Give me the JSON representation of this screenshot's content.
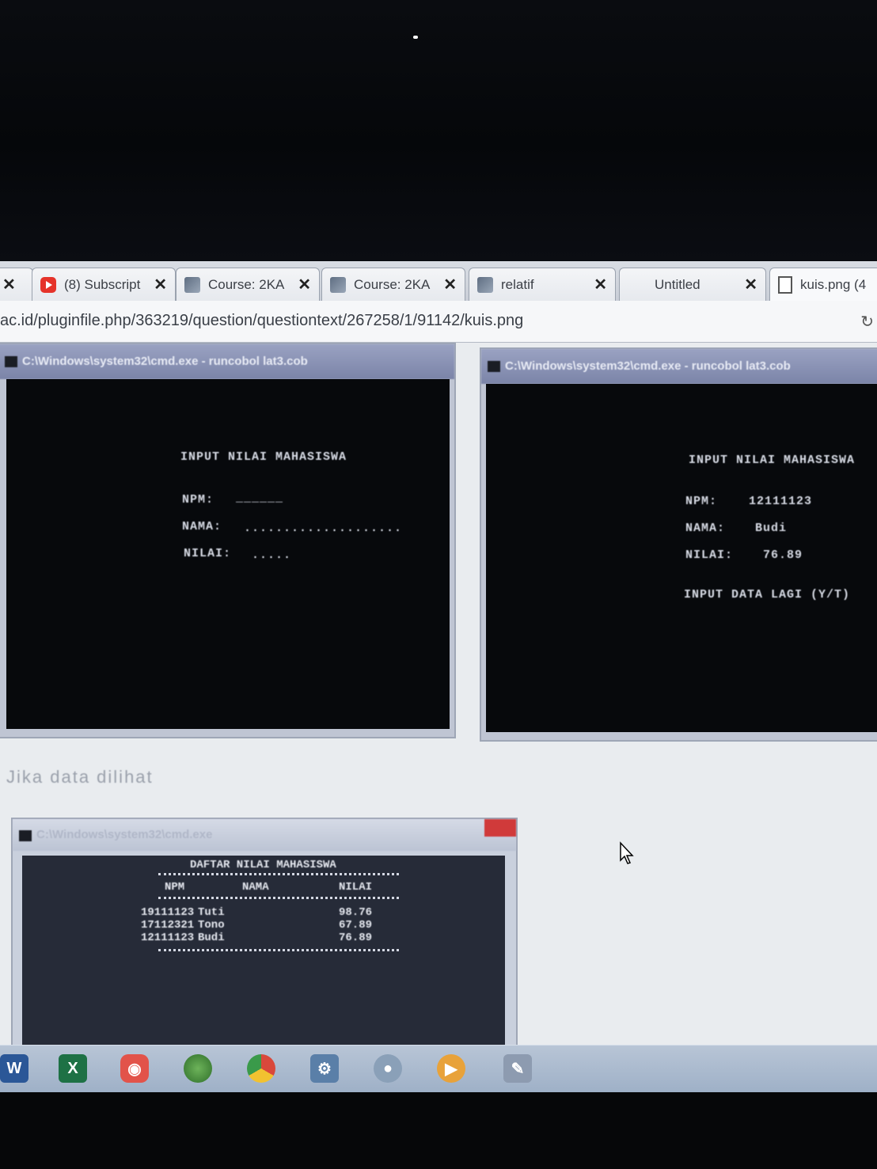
{
  "tabs": [
    {
      "label": "",
      "icon": "close-icon"
    },
    {
      "label": "(8) Subscript",
      "icon": "youtube-icon"
    },
    {
      "label": "Course: 2KA",
      "icon": "course-icon"
    },
    {
      "label": "Course: 2KA",
      "icon": "course-icon"
    },
    {
      "label": "relatif",
      "icon": "course-icon"
    },
    {
      "label": "Untitled",
      "icon": ""
    },
    {
      "label": "kuis.png (4",
      "icon": "document-icon"
    }
  ],
  "address_bar": {
    "url": "ac.id/pluginfile.php/363219/question/questiontext/267258/1/91142/kuis.png"
  },
  "cmd_left": {
    "title": "C:\\Windows\\system32\\cmd.exe - runcobol lat3.cob",
    "heading": "INPUT NILAI MAHASISWA",
    "npm_label": "NPM:",
    "npm_value": "______",
    "nama_label": "NAMA:",
    "nama_value": "....................",
    "nilai_label": "NILAI:",
    "nilai_value": "....."
  },
  "cmd_right": {
    "title": "C:\\Windows\\system32\\cmd.exe - runcobol lat3.cob",
    "heading": "INPUT NILAI MAHASISWA",
    "npm_label": "NPM:",
    "npm_value": "12111123",
    "nama_label": "NAMA:",
    "nama_value": "Budi",
    "nilai_label": "NILAI:",
    "nilai_value": "76.89",
    "prompt": "INPUT DATA LAGI (Y/T)"
  },
  "caption": "Jika data dilihat",
  "cmd_table": {
    "title": "C:\\Windows\\system32\\cmd.exe",
    "heading": "DAFTAR NILAI MAHASISWA",
    "columns": [
      "NPM",
      "NAMA",
      "NILAI"
    ],
    "rows": [
      {
        "npm": "19111123",
        "nama": "Tuti",
        "nilai": "98.76"
      },
      {
        "npm": "17112321",
        "nama": "Tono",
        "nilai": "67.89"
      },
      {
        "npm": "12111123",
        "nama": "Budi",
        "nilai": "76.89"
      }
    ]
  },
  "taskbar": [
    {
      "icon": "word-icon",
      "color": "#2b5797"
    },
    {
      "icon": "excel-icon",
      "color": "#1e7145"
    },
    {
      "icon": "app-icon",
      "color": "#e2534a"
    },
    {
      "icon": "globe-icon",
      "color": "#4a8f3c"
    },
    {
      "icon": "chrome-icon",
      "color": "#e0c53a"
    },
    {
      "icon": "tool-icon",
      "color": "#5a7fa8"
    },
    {
      "icon": "disk-icon",
      "color": "#8aa0b8"
    },
    {
      "icon": "media-icon",
      "color": "#e8a23a"
    },
    {
      "icon": "paint-icon",
      "color": "#8d9bb0"
    }
  ]
}
